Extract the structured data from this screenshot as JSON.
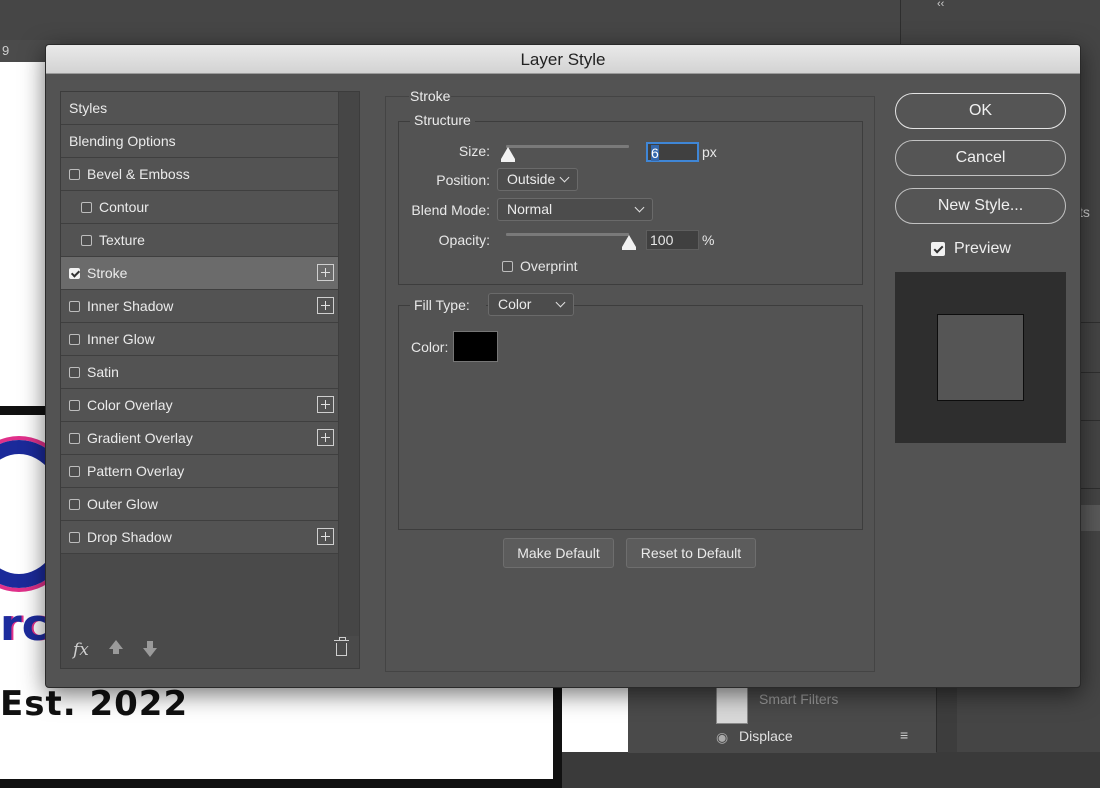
{
  "background": {
    "ruler_number": "9",
    "canvas_text_partial": "rc",
    "canvas_text_bottom": "Est. 2022",
    "layers": {
      "smart_filters": "Smart Filters",
      "displace": "Displace"
    },
    "right_panel_partial": "ts"
  },
  "dialog": {
    "title": "Layer Style",
    "styles_list": [
      {
        "label": "Styles",
        "has_checkbox": false,
        "checked": false,
        "indent": false,
        "has_plus": false,
        "selected": false
      },
      {
        "label": "Blending Options",
        "has_checkbox": false,
        "checked": false,
        "indent": false,
        "has_plus": false,
        "selected": false
      },
      {
        "label": "Bevel & Emboss",
        "has_checkbox": true,
        "checked": false,
        "indent": false,
        "has_plus": false,
        "selected": false
      },
      {
        "label": "Contour",
        "has_checkbox": true,
        "checked": false,
        "indent": true,
        "has_plus": false,
        "selected": false
      },
      {
        "label": "Texture",
        "has_checkbox": true,
        "checked": false,
        "indent": true,
        "has_plus": false,
        "selected": false
      },
      {
        "label": "Stroke",
        "has_checkbox": true,
        "checked": true,
        "indent": false,
        "has_plus": true,
        "selected": true
      },
      {
        "label": "Inner Shadow",
        "has_checkbox": true,
        "checked": false,
        "indent": false,
        "has_plus": true,
        "selected": false
      },
      {
        "label": "Inner Glow",
        "has_checkbox": true,
        "checked": false,
        "indent": false,
        "has_plus": false,
        "selected": false
      },
      {
        "label": "Satin",
        "has_checkbox": true,
        "checked": false,
        "indent": false,
        "has_plus": false,
        "selected": false
      },
      {
        "label": "Color Overlay",
        "has_checkbox": true,
        "checked": false,
        "indent": false,
        "has_plus": true,
        "selected": false
      },
      {
        "label": "Gradient Overlay",
        "has_checkbox": true,
        "checked": false,
        "indent": false,
        "has_plus": true,
        "selected": false
      },
      {
        "label": "Pattern Overlay",
        "has_checkbox": true,
        "checked": false,
        "indent": false,
        "has_plus": false,
        "selected": false
      },
      {
        "label": "Outer Glow",
        "has_checkbox": true,
        "checked": false,
        "indent": false,
        "has_plus": false,
        "selected": false
      },
      {
        "label": "Drop Shadow",
        "has_checkbox": true,
        "checked": false,
        "indent": false,
        "has_plus": true,
        "selected": false
      }
    ],
    "footer": {
      "fx_label": "fx",
      "icons": [
        "fx-icon",
        "move-up-icon",
        "move-down-icon",
        "trash-icon"
      ]
    },
    "stroke": {
      "section_title": "Stroke",
      "structure_title": "Structure",
      "size_label": "Size:",
      "size_value": "6",
      "size_unit": "px",
      "size_slider_fraction": 0.02,
      "position_label": "Position:",
      "position_value": "Outside",
      "blend_mode_label": "Blend Mode:",
      "blend_mode_value": "Normal",
      "opacity_label": "Opacity:",
      "opacity_value": "100",
      "opacity_unit": "%",
      "opacity_slider_fraction": 1.0,
      "overprint_label": "Overprint",
      "overprint_checked": false,
      "fill_type_label": "Fill Type:",
      "fill_type_value": "Color",
      "color_label": "Color:",
      "color_value": "#000000",
      "make_default_label": "Make Default",
      "reset_default_label": "Reset to Default"
    },
    "buttons": {
      "ok": "OK",
      "cancel": "Cancel",
      "new_style": "New Style..."
    },
    "preview": {
      "label": "Preview",
      "checked": true,
      "swatch_color": "#555555"
    }
  }
}
